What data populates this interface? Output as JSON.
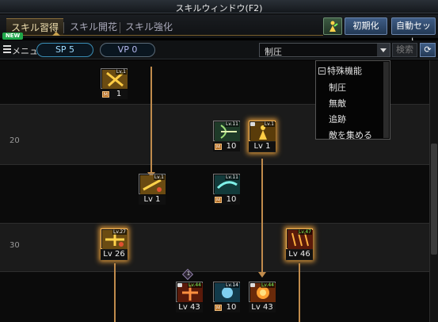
{
  "window": {
    "title": "スキルウィンドウ(F2)"
  },
  "tabs": [
    {
      "label": "スキル習得",
      "active": true
    },
    {
      "label": "スキル開花",
      "active": false
    },
    {
      "label": "スキル強化",
      "active": false
    }
  ],
  "new_badge": "NEW",
  "header_buttons": {
    "reset": "初期化",
    "auto_set": "自動セット"
  },
  "toolbar": {
    "menu_label": "メニュー",
    "sp": "SP 5",
    "vp": "VP 0",
    "filter_selected": "制圧",
    "search_label": "検索",
    "refresh_glyph": "⟳"
  },
  "filter_dropdown": {
    "header": "特殊機能",
    "options": [
      "制圧",
      "無敵",
      "追跡",
      "敵を集める"
    ]
  },
  "row_labels": [
    "20",
    "30"
  ],
  "skills": [
    {
      "id": "s1",
      "tag": "Lv.1",
      "mode": "M",
      "value": "1",
      "glow": false,
      "locked": false
    },
    {
      "id": "s2",
      "tag": "Lv.11",
      "mode": "M",
      "value": "10",
      "glow": false,
      "locked": false
    },
    {
      "id": "s3",
      "tag": "Lv.1",
      "mode": "level",
      "value": "Lv 1",
      "glow": true,
      "locked": true
    },
    {
      "id": "s4",
      "tag": "Lv.1",
      "mode": "level",
      "value": "Lv 1",
      "glow": false,
      "locked": false
    },
    {
      "id": "s5",
      "tag": "Lv.11",
      "mode": "M",
      "value": "10",
      "glow": false,
      "locked": false
    },
    {
      "id": "s6",
      "tag": "Lv.27",
      "mode": "level",
      "value": "Lv 26",
      "glow": true,
      "locked": false
    },
    {
      "id": "s7",
      "tag": "Lv.47",
      "mode": "level",
      "value": "Lv 46",
      "glow": true,
      "locked": false,
      "green": true
    },
    {
      "id": "s8",
      "tag": "Lv.44",
      "mode": "level",
      "value": "Lv 43",
      "glow": false,
      "locked": true,
      "green": true
    },
    {
      "id": "s9",
      "tag": "Lv.14",
      "mode": "M",
      "value": "10",
      "glow": false,
      "locked": false
    },
    {
      "id": "s10",
      "tag": "Lv.44",
      "mode": "level",
      "value": "Lv 43",
      "glow": false,
      "locked": true,
      "green": true
    }
  ],
  "requirement_marker": "1",
  "colors": {
    "accent": "#c08b4c",
    "glow": "#e09a3a",
    "sp": "#3b8fb7",
    "button": "#3f5d86"
  }
}
